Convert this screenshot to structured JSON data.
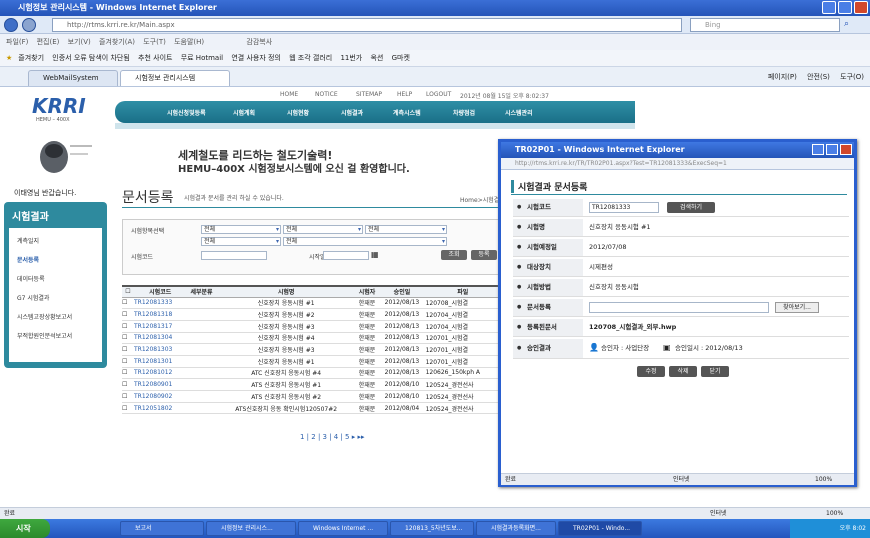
{
  "browser": {
    "title": "시험정보 관리시스템 - Windows Internet Explorer",
    "url": "http://rtms.krri.re.kr/Main.aspx",
    "search_placeholder": "Bing",
    "menu": [
      "파일(F)",
      "편집(E)",
      "보기(V)",
      "즐겨찾기(A)",
      "도구(T)",
      "도움말(H)"
    ],
    "menu_extra": "감감복사",
    "favorites_label": "즐겨찾기",
    "favorites": [
      "인증서 오류 탐색이 차단됨",
      "추천 사이트",
      "무료 Hotmail",
      "연결 사용자 정의",
      "웹 조각 갤러리",
      "11번가",
      "옥션",
      "G마켓"
    ],
    "tabs": [
      "WebMailSystem",
      "시험정보 관리시스템"
    ],
    "tools": [
      "페이지(P)",
      "안전(S)",
      "도구(O)"
    ],
    "status_left": "완료",
    "status_zone": "인터넷",
    "zoom": "100%"
  },
  "site": {
    "top_links": [
      "HOME",
      "NOTICE",
      "SITEMAP",
      "HELP",
      "LOGOUT"
    ],
    "datetime": "2012년 08월 15일 오후 8:02:37",
    "nav": [
      "시험신청및등록",
      "시험계획",
      "시험현황",
      "시험결과",
      "계측시스템",
      "차량점검",
      "시스템관리"
    ],
    "logo_text": "KRRI",
    "logo_sub": "HEMU – 400X",
    "headline1": "세계철도를 리드하는 철도기술력!",
    "headline2": "HEMU–400X 시험정보시스템에 오신 걸 환영합니다.",
    "welcome": "이태영님 반갑습니다.",
    "sidebar_title": "시험결과",
    "sidebar_items": [
      "계측일지",
      "문서등록",
      "데이터등록",
      "G7 시험결과",
      "시스템고장상황보고서",
      "부적합원인분석보고서"
    ],
    "page_title": "문서등록",
    "page_desc": "시험결과 문서를 관리 하실 수 있습니다.",
    "breadcrumb": "Home>시험결",
    "search": {
      "item_label": "시험항목선택",
      "select_value": "전체",
      "code_label": "시험코드",
      "start_label": "시작일자",
      "btn_search": "조회",
      "btn_register": "등록"
    },
    "table": {
      "headers": [
        "시험코드",
        "세부분류",
        "시험명",
        "시험자",
        "승인일",
        "파일"
      ],
      "rows": [
        [
          "TR12081333",
          "",
          "신호장치 응동시험 #1",
          "한재문",
          "2012/08/13",
          "120708_시험결"
        ],
        [
          "TR12081318",
          "",
          "신호장치 응동시험 #2",
          "한재문",
          "2012/08/13",
          "120704_시험결"
        ],
        [
          "TR12081317",
          "",
          "신호장치 응동시험 #3",
          "한재문",
          "2012/08/13",
          "120704_시험결"
        ],
        [
          "TR12081304",
          "",
          "신호장치 응동시험 #4",
          "한재문",
          "2012/08/13",
          "120701_시험결"
        ],
        [
          "TR12081303",
          "",
          "신호장치 응동시험 #3",
          "한재문",
          "2012/08/13",
          "120701_시험결"
        ],
        [
          "TR12081301",
          "",
          "신호장치 응동시험 #1",
          "한재문",
          "2012/08/13",
          "120701_시험결"
        ],
        [
          "TR12081012",
          "",
          "ATC 신호장치 응동시험 #4",
          "한재문",
          "2012/08/13",
          "120626_150kph A"
        ],
        [
          "TR12080901",
          "",
          "ATS 신호장치 응동시험 #1",
          "한재문",
          "2012/08/10",
          "120524_경전선사"
        ],
        [
          "TR12080902",
          "",
          "ATS 신호장치 응동시험 #2",
          "한재문",
          "2012/08/10",
          "120524_경전선사"
        ],
        [
          "TR12051802",
          "",
          "ATS신호장치 응동 확인시험120507#2",
          "한재문",
          "2012/08/04",
          "120524_경전선사"
        ]
      ]
    },
    "pager": "1 | 2 | 3 | 4 | 5 ▸ ▸▸"
  },
  "popup": {
    "title": "TR02P01 - Windows Internet Explorer",
    "url": "http://rtms.krri.re.kr/TR/TR02P01.aspx?Test=TR12081333&ExecSeq=1",
    "heading": "시험결과 문서등록",
    "fields": {
      "code_label": "시험코드",
      "code_value": "TR12081333",
      "code_btn": "검색하기",
      "name_label": "시험명",
      "name_value": "신호장치 응동시험 #1",
      "date_label": "시험예정일",
      "date_value": "2012/07/08",
      "target_label": "대상장치",
      "target_value": "시제편성",
      "method_label": "시험방법",
      "method_value": "신호장치 응동시험",
      "doc_label": "문서등록",
      "doc_btn": "찾아보기...",
      "registered_label": "등록된문서",
      "registered_value": "120708_시험결과_외부.hwp",
      "approval_label": "승인결과",
      "approver": "승인자 : 사업단장",
      "approval_date": "승인일시 : 2012/08/13"
    },
    "buttons": [
      "수정",
      "삭제",
      "닫기"
    ],
    "status_left": "완료",
    "status_zone": "인터넷",
    "zoom": "100%"
  },
  "taskbar": {
    "start": "시작",
    "items": [
      "보고서",
      "시험정보 관리시스...",
      "Windows Internet ...",
      "120813_5차년도보...",
      "시험결과등록화면...",
      "TR02P01 - Windo..."
    ],
    "clock": "오후 8:02"
  }
}
